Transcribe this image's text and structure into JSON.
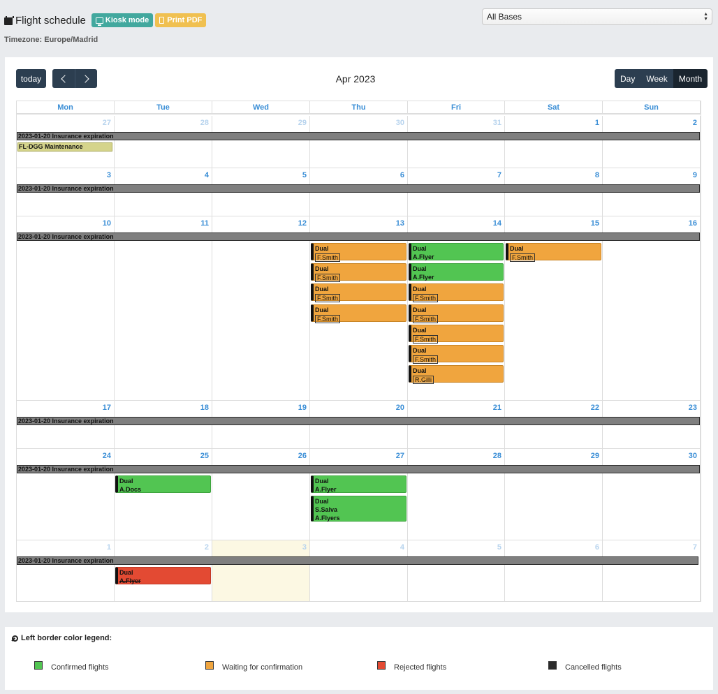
{
  "header": {
    "title": "Flight schedule",
    "kiosk_label": "Kiosk mode",
    "pdf_label": "Print PDF",
    "timezone": "Timezone: Europe/Madrid",
    "base_select_value": "All Bases"
  },
  "toolbar": {
    "today_label": "today",
    "title": "Apr 2023",
    "views": [
      "Day",
      "Week",
      "Month"
    ],
    "active_view": "Month"
  },
  "weekdays": [
    "Mon",
    "Tue",
    "Wed",
    "Thu",
    "Fri",
    "Sat",
    "Sun"
  ],
  "weeks": [
    [
      "27",
      "28",
      "29",
      "30",
      "31",
      "1",
      "2"
    ],
    [
      "3",
      "4",
      "5",
      "6",
      "7",
      "8",
      "9"
    ],
    [
      "10",
      "11",
      "12",
      "13",
      "14",
      "15",
      "16"
    ],
    [
      "17",
      "18",
      "19",
      "20",
      "21",
      "22",
      "23"
    ],
    [
      "24",
      "25",
      "26",
      "27",
      "28",
      "29",
      "30"
    ],
    [
      "1",
      "2",
      "3",
      "4",
      "5",
      "6",
      "7"
    ]
  ],
  "insurance_label": "2023-01-20 Insurance expiration",
  "maintenance_label": "FL-DGG Maintenance",
  "events": [
    {
      "type": "Dual",
      "people": [
        "F.Smith"
      ],
      "status": "waiting"
    },
    {
      "type": "Dual",
      "people": [
        "F.Smith"
      ],
      "status": "waiting"
    },
    {
      "type": "Dual",
      "people": [
        "F.Smith"
      ],
      "status": "waiting"
    },
    {
      "type": "Dual",
      "people": [
        "F.Smith"
      ],
      "status": "waiting"
    },
    {
      "type": "Dual",
      "people": [
        "A.Flyer"
      ],
      "status": "confirmed"
    },
    {
      "type": "Dual",
      "people": [
        "A.Flyer"
      ],
      "status": "confirmed"
    },
    {
      "type": "Dual",
      "people": [
        "F.Smith"
      ],
      "status": "waiting"
    },
    {
      "type": "Dual",
      "people": [
        "F.Smith"
      ],
      "status": "waiting"
    },
    {
      "type": "Dual",
      "people": [
        "F.Smith"
      ],
      "status": "waiting"
    },
    {
      "type": "Dual",
      "people": [
        "F.Smith"
      ],
      "status": "waiting"
    },
    {
      "type": "Dual",
      "people": [
        "R.Gilli"
      ],
      "status": "waiting"
    },
    {
      "type": "Dual",
      "people": [
        "F.Smith"
      ],
      "status": "waiting"
    },
    {
      "type": "Dual",
      "people": [
        "A.Docs"
      ],
      "status": "confirmed"
    },
    {
      "type": "Dual",
      "people": [
        "A.Flyer"
      ],
      "status": "confirmed"
    },
    {
      "type": "Dual",
      "people": [
        "S.Salva",
        "A.Flyers"
      ],
      "status": "confirmed"
    },
    {
      "type": "Dual",
      "people": [
        "A.Flyer"
      ],
      "status": "rejected"
    }
  ],
  "legend": {
    "title": "Left border color legend:",
    "items": [
      {
        "label": "Confirmed flights",
        "color": "#52c552"
      },
      {
        "label": "Waiting for confirmation",
        "color": "#f0a53e"
      },
      {
        "label": "Rejected flights",
        "color": "#e34a33"
      },
      {
        "label": "Cancelled flights",
        "color": "#2b2b2b"
      }
    ]
  }
}
